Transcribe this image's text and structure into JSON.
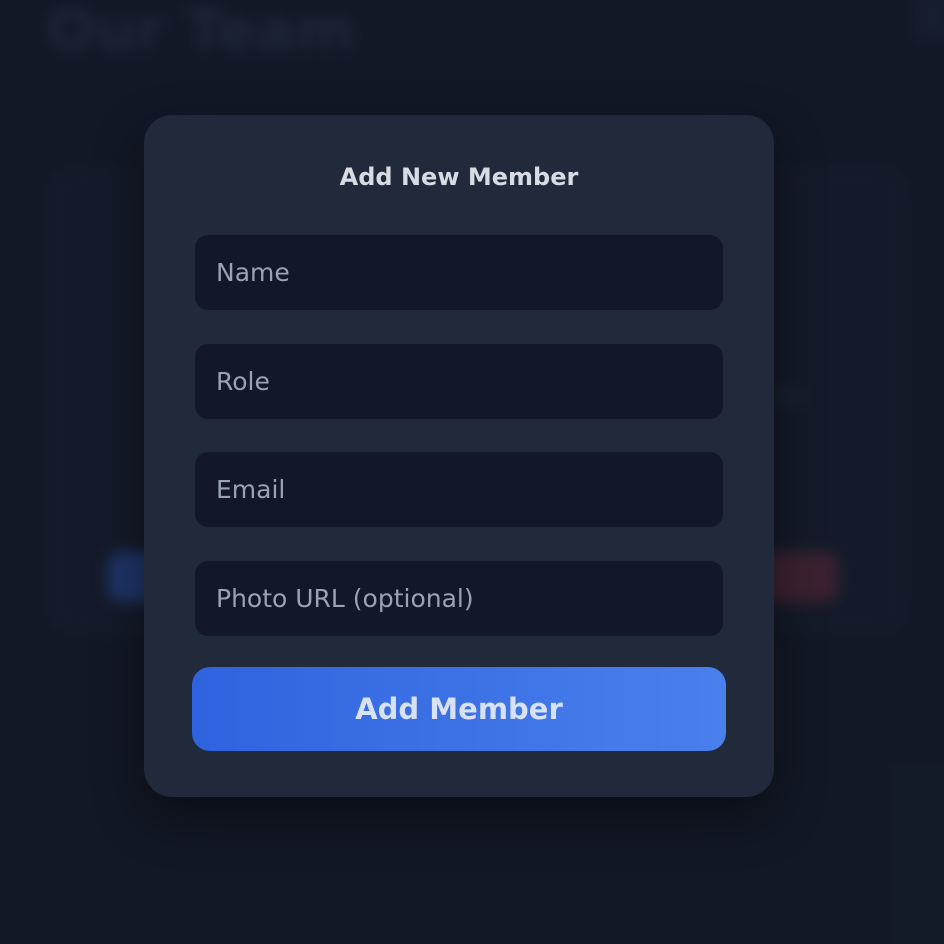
{
  "background": {
    "page_title": "Our Team"
  },
  "modal": {
    "title": "Add New Member",
    "fields": {
      "name": {
        "placeholder": "Name",
        "value": ""
      },
      "role": {
        "placeholder": "Role",
        "value": ""
      },
      "email": {
        "placeholder": "Email",
        "value": ""
      },
      "photo_url": {
        "placeholder": "Photo URL (optional)",
        "value": ""
      }
    },
    "submit_label": "Add Member"
  },
  "colors": {
    "page_background": "#131a29",
    "modal_background": "#212a3b",
    "input_background": "#121827",
    "accent_start": "#2f63df",
    "accent_end": "#4a80ec"
  }
}
